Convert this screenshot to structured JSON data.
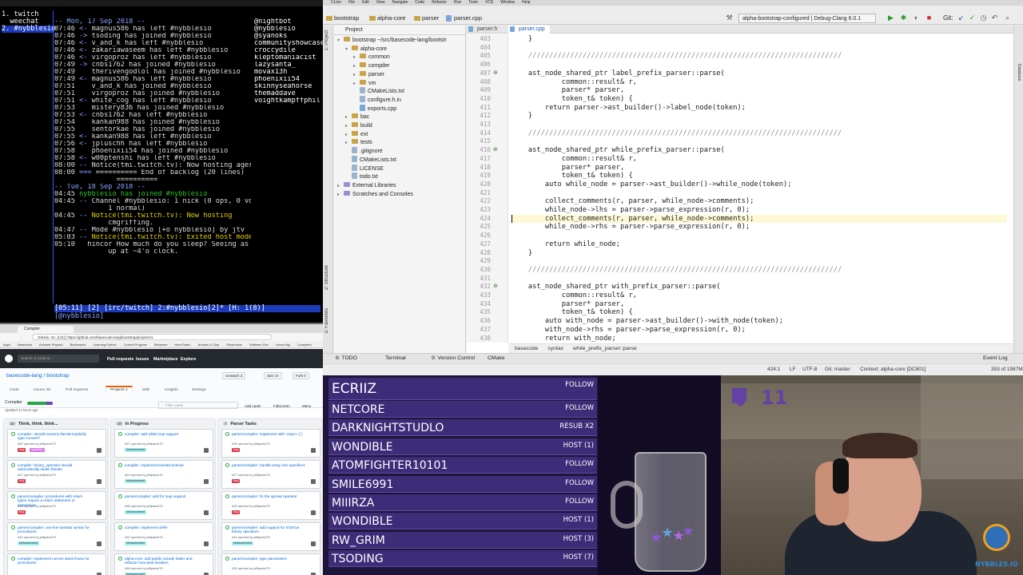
{
  "terminal": {
    "buffers": [
      "1. twitch",
      "  weechat",
      "2. #nybblesio"
    ],
    "chat_lines": [
      {
        "t": "",
        "p": "-- ",
        "msg": "Mon, 17 Sep 2018 --",
        "c": "d"
      },
      {
        "t": "07:46",
        "p": " <- ",
        "msg": "magnus586 has left #nybblesio",
        "c": "t"
      },
      {
        "t": "07:46",
        "p": " -> ",
        "msg": "tsoding has joined #nybblesio",
        "c": "t"
      },
      {
        "t": "07:46",
        "p": " <- ",
        "msg": "v_and_k has left #nybblesio",
        "c": "t"
      },
      {
        "t": "07:46",
        "p": " <- ",
        "msg": "zakariawaseem has left #nybblesio",
        "c": "t"
      },
      {
        "t": "07:46",
        "p": " <- ",
        "msg": "virgoproz has left #nybblesio",
        "c": "t"
      },
      {
        "t": "07:49",
        "p": " -> ",
        "msg": "cnbs1762 has joined #nybblesio",
        "c": "t"
      },
      {
        "t": "07:49",
        "p": "    ",
        "msg": "therivengodlol has joined #nybblesio",
        "c": "t"
      },
      {
        "t": "07:49",
        "p": " <- ",
        "msg": "magnus586 has left #nybblesio",
        "c": "t"
      },
      {
        "t": "07:51",
        "p": "    ",
        "msg": "v_and_k has joined #nybblesio",
        "c": "t"
      },
      {
        "t": "07:51",
        "p": "    ",
        "msg": "virgoproz has joined #nybblesio",
        "c": "t"
      },
      {
        "t": "07:51",
        "p": " <- ",
        "msg": "white_cog has left #nybblesio",
        "c": "t"
      },
      {
        "t": "07:53",
        "p": "    ",
        "msg": "mistery836 has joined #nybblesio",
        "c": "t"
      },
      {
        "t": "07:53",
        "p": " <- ",
        "msg": "cnbs1762 has left #nybblesio",
        "c": "t"
      },
      {
        "t": "07:54",
        "p": "    ",
        "msg": "kankan988 has joined #nybblesio",
        "c": "t"
      },
      {
        "t": "07:55",
        "p": "    ",
        "msg": "sentorkae has joined #nybblesio",
        "c": "t"
      },
      {
        "t": "07:55",
        "p": " <- ",
        "msg": "kankan988 has left #nybblesio",
        "c": "t"
      },
      {
        "t": "07:56",
        "p": " <- ",
        "msg": "jpluschh has left #nybblesio",
        "c": "t"
      },
      {
        "t": "07:58",
        "p": "    ",
        "msg": "phoenixii54 has joined #nybblesio",
        "c": "t"
      },
      {
        "t": "07:58",
        "p": " <- ",
        "msg": "w00ptenshi has left #nybblesio",
        "c": "t"
      },
      {
        "t": "08:00",
        "p": " -- ",
        "msg": "Notice(tmi.twitch.tv): Now hosting agerarg.",
        "c": "t"
      },
      {
        "t": "08:00",
        "p": " === ",
        "msg": "========== End of backlog (20 lines)",
        "c": "t"
      },
      {
        "t": "",
        "p": "     ",
        "msg": "          ==========",
        "c": "t"
      },
      {
        "t": "",
        "p": "-- ",
        "msg": "Tue, 18 Sep 2018 --",
        "c": "d"
      },
      {
        "t": "04:45",
        "p": " ",
        "msg": "nybblesio has joined #nybblesio",
        "c": "g"
      },
      {
        "t": "04:45",
        "p": " -- ",
        "msg": "Channel #nybblesio: 1 nick (0 ops, 0 voices,",
        "c": "t"
      },
      {
        "t": "",
        "p": "     ",
        "msg": "        1 normal)",
        "c": "t"
      },
      {
        "t": "04:45",
        "p": " -- ",
        "msg": "Notice(tmi.twitch.tv): Now hosting",
        "c": "y"
      },
      {
        "t": "",
        "p": "     ",
        "msg": "        cmgriffing.",
        "c": "t"
      },
      {
        "t": "04:47",
        "p": " -- ",
        "msg": "Mode #nybblesio [+o nybblesio] by jtv",
        "c": "t"
      },
      {
        "t": "05:03",
        "p": " -- ",
        "msg": "Notice(tmi.twitch.tv): Exited host mode.",
        "c": "y"
      },
      {
        "t": "05:10",
        "p": "   ",
        "msg": "hincor How much do you sleep? Seeing as you wake",
        "c": "t"
      },
      {
        "t": "",
        "p": "     ",
        "msg": "        up at ~4'o clock.",
        "c": "t"
      }
    ],
    "nicks": [
      "@nightbot",
      "@nybblesio",
      "@syanoks",
      "communityshowcase",
      "croccydile",
      "kleptomaniacist",
      "lazysanta_",
      "movax13h",
      "phoenixii54",
      "skinnyseahorse",
      "themaddave",
      "voightkampffphil"
    ],
    "status_bar": "[05:11] [2] [irc/twitch] 2:#nybblesio[2]* [H: 1(8)]",
    "input_prompt": "[@nybblesio]"
  },
  "ide": {
    "menu": [
      "CLion",
      "File",
      "Edit",
      "View",
      "Navigate",
      "Code",
      "Refactor",
      "Run",
      "Tools",
      "VCS",
      "Window",
      "Help"
    ],
    "breadcrumbs": [
      "bootstrap",
      "alpha-core",
      "parser",
      "parser.cpp"
    ],
    "run_config": "alpha-bootstrap-configured | Debug-Clang 6.0.1",
    "git_label": "Git:",
    "project_header": "Project",
    "tree": [
      {
        "label": "bootstrap ~/src/basecode-lang/bootstr",
        "kind": "folder",
        "depth": 0,
        "open": true
      },
      {
        "label": "alpha-core",
        "kind": "folder",
        "depth": 1,
        "open": true
      },
      {
        "label": "common",
        "kind": "folder",
        "depth": 2,
        "open": false
      },
      {
        "label": "compiler",
        "kind": "folder",
        "depth": 2,
        "open": false
      },
      {
        "label": "parser",
        "kind": "folder",
        "depth": 2,
        "open": false
      },
      {
        "label": "vm",
        "kind": "folder",
        "depth": 2,
        "open": false
      },
      {
        "label": "CMakeLists.txt",
        "kind": "file",
        "depth": 2
      },
      {
        "label": "configure.h.in",
        "kind": "file",
        "depth": 2
      },
      {
        "label": "exports.cpp",
        "kind": "cpp",
        "depth": 2
      },
      {
        "label": "bac",
        "kind": "folder",
        "depth": 1,
        "open": false
      },
      {
        "label": "build",
        "kind": "folder",
        "depth": 1,
        "open": false
      },
      {
        "label": "ext",
        "kind": "folder",
        "depth": 1,
        "open": false
      },
      {
        "label": "tests",
        "kind": "folder",
        "depth": 1,
        "open": false
      },
      {
        "label": ".gitignore",
        "kind": "file",
        "depth": 1
      },
      {
        "label": "CMakeLists.txt",
        "kind": "file",
        "depth": 1
      },
      {
        "label": "LICENSE",
        "kind": "file",
        "depth": 1
      },
      {
        "label": "todo.txt",
        "kind": "file",
        "depth": 1
      },
      {
        "label": "External Libraries",
        "kind": "lib",
        "depth": 0,
        "open": false
      },
      {
        "label": "Scratches and Consoles",
        "kind": "lib",
        "depth": 0,
        "open": false
      }
    ],
    "editor_tabs": [
      "parser.h",
      "parser.cpp"
    ],
    "code_lines": [
      {
        "n": 403,
        "text": "    }"
      },
      {
        "n": 404,
        "text": ""
      },
      {
        "n": 405,
        "text": "    ///////////////////////////////////////////////////////////////////////////",
        "cls": "cm"
      },
      {
        "n": 406,
        "text": ""
      },
      {
        "n": 407,
        "text": "    ast_node_shared_ptr label_prefix_parser::parse(",
        "mark": true
      },
      {
        "n": 408,
        "text": "            common::result& r,"
      },
      {
        "n": 409,
        "text": "            parser* parser,"
      },
      {
        "n": 410,
        "text": "            token_t& token) {"
      },
      {
        "n": 411,
        "text": "        return parser->ast_builder()->label_node(token);"
      },
      {
        "n": 412,
        "text": "    }"
      },
      {
        "n": 413,
        "text": ""
      },
      {
        "n": 414,
        "text": "    ///////////////////////////////////////////////////////////////////////////",
        "cls": "cm"
      },
      {
        "n": 415,
        "text": ""
      },
      {
        "n": 416,
        "text": "    ast_node_shared_ptr while_prefix_parser::parse(",
        "mark": true
      },
      {
        "n": 417,
        "text": "            common::result& r,"
      },
      {
        "n": 418,
        "text": "            parser* parser,"
      },
      {
        "n": 419,
        "text": "            token_t& token) {"
      },
      {
        "n": 420,
        "text": "        auto while_node = parser->ast_builder()->while_node(token);"
      },
      {
        "n": 421,
        "text": ""
      },
      {
        "n": 422,
        "text": "        collect_comments(r, parser, while_node->comments);"
      },
      {
        "n": 423,
        "text": "        while_node->lhs = parser->parse_expression(r, 0);"
      },
      {
        "n": 424,
        "text": "        collect_comments(r, parser, while_node->comments);",
        "current": true
      },
      {
        "n": 425,
        "text": "        while_node->rhs = parser->parse_expression(r, 0);"
      },
      {
        "n": 426,
        "text": ""
      },
      {
        "n": 427,
        "text": "        return while_node;"
      },
      {
        "n": 428,
        "text": "    }"
      },
      {
        "n": 429,
        "text": ""
      },
      {
        "n": 430,
        "text": "    ///////////////////////////////////////////////////////////////////////////",
        "cls": "cm"
      },
      {
        "n": 431,
        "text": ""
      },
      {
        "n": 432,
        "text": "    ast_node_shared_ptr with_prefix_parser::parse(",
        "mark": true
      },
      {
        "n": 433,
        "text": "            common::result& r,"
      },
      {
        "n": 434,
        "text": "            parser* parser,"
      },
      {
        "n": 435,
        "text": "            token_t& token) {"
      },
      {
        "n": 436,
        "text": "        auto with_node = parser->ast_builder()->with_node(token);"
      },
      {
        "n": 437,
        "text": "        with_node->rhs = parser->parse_expression(r, 0);"
      },
      {
        "n": 438,
        "text": "        return with_node;"
      }
    ],
    "editor_breadcrumb": [
      "basecode",
      "syntax",
      "while_prefix_parser::parse"
    ],
    "bottom_tabs": [
      "6: TODO",
      "Terminal",
      "9: Version Control",
      "CMake"
    ],
    "event_log": "Event Log",
    "status": {
      "position": "424:1",
      "line_endings": "LF",
      "encoding": "UTF-8",
      "git": "Git: master",
      "context": "Context: alpha-core [DC801]",
      "memory": "353 of 1987M"
    },
    "left_vtabs": [
      "1: Project",
      "2: Structure",
      "2: Favorites"
    ],
    "right_vtabs": [
      "Database"
    ]
  },
  "browser": {
    "tab_label": "Compiler",
    "url": "GitHub, Inc. [US] | https://github.com/basecode-lang/bootstrap/projects/1",
    "bookmarks": [
      "Apps",
      "Basecode",
      "Animate Physics",
      "Bookmarks",
      "Learning Python",
      "Control Program",
      "Bitsavers",
      "Ham Radio",
      "Arduino & Chip",
      "Electronics",
      "Software Dev",
      "Linear Alg",
      "Compilers"
    ],
    "gh_search_placeholder": "Search or jump to...",
    "gh_nav": [
      "Pull requests",
      "Issues",
      "Marketplace",
      "Explore"
    ],
    "repo_title": "basecode-lang / bootstrap",
    "repo_buttons": [
      {
        "label": "Unwatch",
        "count": "3"
      },
      {
        "label": "Star",
        "count": "10"
      },
      {
        "label": "Fork",
        "count": "0"
      }
    ],
    "repo_tabs": [
      "Code",
      "Issues 48",
      "Pull requests",
      "Projects 1",
      "Wiki",
      "Insights",
      "Settings"
    ],
    "project_name": "Compiler",
    "project_updated": "Updated 12 hours ago",
    "filter_placeholder": "Filter cards",
    "project_actions": [
      "Add cards",
      "Fullscreen",
      "Menu"
    ],
    "columns": [
      {
        "title": "Think, think, think...",
        "count": "10",
        "cards": [
          {
            "title": "compiler: should numeric literals implicitly type convert?",
            "meta": "#60 opened by jeffpanici75",
            "labels": [
              {
                "t": "bug",
                "k": "bug"
              },
              {
                "t": "question",
                "k": "q"
              }
            ]
          },
          {
            "title": "compiler: binary_operator should automatically widen literals",
            "meta": "#67 opened by jeffpanici75",
            "labels": [
              {
                "t": "bug",
                "k": "bug"
              }
            ]
          },
          {
            "title": "parser/compiler: procedures with return types require a return statement or expression",
            "meta": "#42 opened by jeffpanici75",
            "labels": [
              {
                "t": "bug",
                "k": "bug"
              }
            ]
          },
          {
            "title": "parser/compiler: one-line lambda syntax for procedures",
            "meta": "#40 opened by jeffpanici75",
            "labels": [
              {
                "t": "enhancement",
                "k": "enh"
              }
            ]
          },
          {
            "title": "compiler: implement correct stack frame for procedures",
            "meta": "",
            "labels": []
          }
        ]
      },
      {
        "title": "In Progress",
        "count": "10",
        "cards": [
          {
            "title": "compiler: add while loop support",
            "meta": "#37 opened by jeffpanici75",
            "labels": [
              {
                "t": "enhancement",
                "k": "enh"
              }
            ]
          },
          {
            "title": "compiler: implement break/continue",
            "meta": "#53 opened by jeffpanici75",
            "labels": [
              {
                "t": "enhancement",
                "k": "enh"
              }
            ]
          },
          {
            "title": "parser/compiler: add for loop support",
            "meta": "#36 opened by jeffpanici75",
            "labels": [
              {
                "t": "enhancement",
                "k": "enh"
              }
            ]
          },
          {
            "title": "compiler: implement defer",
            "meta": "#32 opened by jeffpanici75",
            "labels": [
              {
                "t": "enhancement",
                "k": "enh"
              }
            ]
          },
          {
            "title": "alpha-core: add public include folder and refactor host-dest headers",
            "meta": "#56 opened by jeffpanici75",
            "labels": [
              {
                "t": "enhancement",
                "k": "enh"
              }
            ]
          }
        ]
      },
      {
        "title": "Parser Tasks",
        "count": "7",
        "cards": [
          {
            "title": "parser/compiler: implement with <expr> { }",
            "meta": "#35 opened by jeffpanici75",
            "labels": [
              {
                "t": "bug",
                "k": "bug"
              }
            ]
          },
          {
            "title": "parser/compiler: handle array size specifiers",
            "meta": "#27 opened by jeffpanici75",
            "labels": [
              {
                "t": "bug",
                "k": "bug"
              }
            ]
          },
          {
            "title": "parser/compiler: fix the spread operator",
            "meta": "#26 opened by jeffpanici75",
            "labels": [
              {
                "t": "bug",
                "k": "bug"
              }
            ]
          },
          {
            "title": "parser/compiler: add support for shortcut binary operators",
            "meta": "#44 opened by jeffpanici75",
            "labels": [
              {
                "t": "enhancement",
                "k": "enh"
              }
            ]
          },
          {
            "title": "parser/compiler: type parameters",
            "meta": "#30 opened by jeffpanici75",
            "labels": []
          }
        ]
      }
    ]
  },
  "alerts": [
    {
      "name": "ECRIIZ",
      "type": "FOLLOW"
    },
    {
      "name": "NETCORE",
      "type": "FOLLOW"
    },
    {
      "name": "DARKNIGHTSTUDLO",
      "type": "RESUB X2"
    },
    {
      "name": "WONDIBLE",
      "type": "HOST (1)"
    },
    {
      "name": "ATOMFIGHTER10101",
      "type": "FOLLOW"
    },
    {
      "name": "SMILE6991",
      "type": "FOLLOW"
    },
    {
      "name": "MIIIRZA",
      "type": "FOLLOW"
    },
    {
      "name": "WONDIBLE",
      "type": "HOST (1)"
    },
    {
      "name": "RW_GRIM",
      "type": "HOST (3)"
    },
    {
      "name": "TSODING",
      "type": "HOST (7)"
    }
  ],
  "webcam": {
    "badge_number": "11",
    "logo_text": "NYBBLES.IO"
  },
  "colors": {
    "weechat_blue": "#1c3bb8",
    "alert_bg": "#3d2c78",
    "twitch_purple": "#6441a5",
    "github_dark": "#24292e"
  }
}
